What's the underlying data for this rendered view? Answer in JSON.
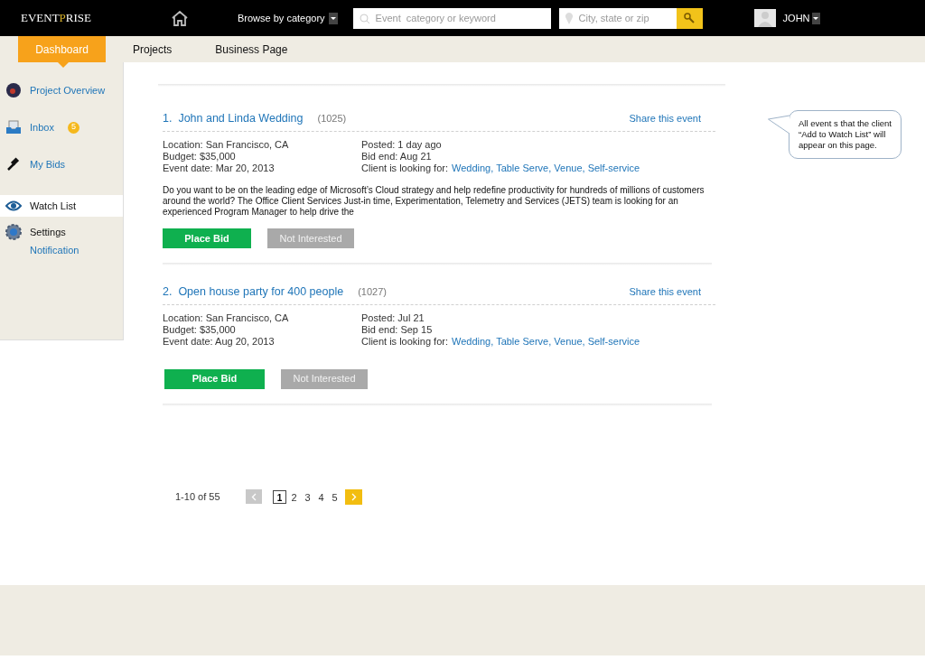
{
  "header": {
    "logo": {
      "before": "EVENT",
      "accent": "P",
      "after": "RISE"
    },
    "browse": "Browse by category",
    "search_placeholder": "Event  category or keyword",
    "location_placeholder": "City, state or zip",
    "user": "JOHN"
  },
  "nav_tabs": [
    {
      "label": "Dashboard",
      "selected": true
    },
    {
      "label": "Projects",
      "selected": false
    },
    {
      "label": "Business Page",
      "selected": false
    }
  ],
  "sidebar": {
    "items": [
      {
        "label": "Project Overview",
        "selected": false
      },
      {
        "label": "Inbox",
        "badge": "5",
        "selected": false
      },
      {
        "label": "My Bids",
        "selected": false
      },
      {
        "label": "Watch List",
        "selected": true
      },
      {
        "label": "Settings",
        "selected": false,
        "children": [
          {
            "label": "Notification"
          }
        ]
      }
    ]
  },
  "events": [
    {
      "number": "1.",
      "title": "John and Linda Wedding",
      "id": "(1025)",
      "share": "Share this event",
      "location": "Location: San Francisco, CA",
      "budget": "Budget: $35,000",
      "event_date": "Event date: Mar 20, 2013",
      "posted": "Posted: 1 day ago",
      "bid_end": "Bid end: Aug 21",
      "looking_for_label": "Client is looking for:",
      "looking_for": "Wedding, Table Serve, Venue, Self-service",
      "description": "Do you want to be on the leading edge of Microsoft’s Cloud strategy and help redefine productivity for hundreds of millions of customers around the world? The Office Client Services Just-in time, Experimentation, Telemetry and Services (JETS) team is looking for an experienced Program Manager to help drive the",
      "buttons": [
        "Place Bid",
        "Not Interested"
      ]
    },
    {
      "number": "2.",
      "title": "Open house party for 400 people",
      "id": "(1027)",
      "share": "Share this event",
      "location": "Location: San Francisco, CA",
      "budget": "Budget: $35,000",
      "event_date": "Event date: Aug 20, 2013",
      "posted": "Posted: Jul 21",
      "bid_end": "Bid end: Sep 15",
      "looking_for_label": "Client is looking for:",
      "looking_for": "Wedding, Table Serve, Venue, Self-service",
      "buttons": [
        "Place Bid",
        "Not Interested"
      ]
    }
  ],
  "pagination": {
    "range": "1-10 of 55",
    "pages": [
      {
        "label": "1",
        "selected": true
      },
      {
        "label": "2",
        "selected": false
      },
      {
        "label": "3",
        "selected": false
      },
      {
        "label": "4",
        "selected": false
      },
      {
        "label": "5",
        "selected": false
      }
    ]
  },
  "note": "All event s that the client “Add to Watch List” will appear on this page."
}
